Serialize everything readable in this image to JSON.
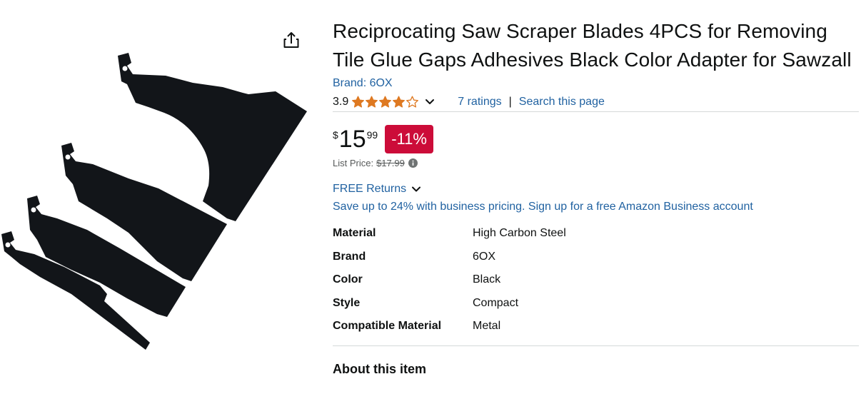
{
  "product": {
    "title": "Reciprocating Saw Scraper Blades 4PCS for Removing Tile Glue Gaps Adhesives Black Color Adapter for Sawzall",
    "brand_link": "Brand: 6OX",
    "rating_value": "3.9",
    "rating_stars": 3.9,
    "ratings_count": "7 ratings",
    "ratings_separator": "|",
    "search_page": "Search this page",
    "price": {
      "symbol": "$",
      "whole": "15",
      "fraction": "99",
      "discount": "-11%"
    },
    "list_price_label": "List Price:",
    "list_price_value": "$17.99",
    "free_returns": "FREE Returns",
    "business_pricing": "Save up to 24% with business pricing. Sign up for a free Amazon Business account",
    "specs": [
      {
        "key": "Material",
        "value": "High Carbon Steel"
      },
      {
        "key": "Brand",
        "value": "6OX"
      },
      {
        "key": "Color",
        "value": "Black"
      },
      {
        "key": "Style",
        "value": "Compact"
      },
      {
        "key": "Compatible Material",
        "value": "Metal"
      }
    ],
    "about_heading": "About this item"
  },
  "icons": {
    "share": "share-icon",
    "chevron": "chevron-down-icon",
    "info": "info-icon",
    "star": "star-icon"
  },
  "colors": {
    "link": "#2162a1",
    "star": "#de7921",
    "discount_bg": "#cc0c39",
    "text": "#0f1111",
    "muted": "#565959",
    "blade": "#111418"
  }
}
